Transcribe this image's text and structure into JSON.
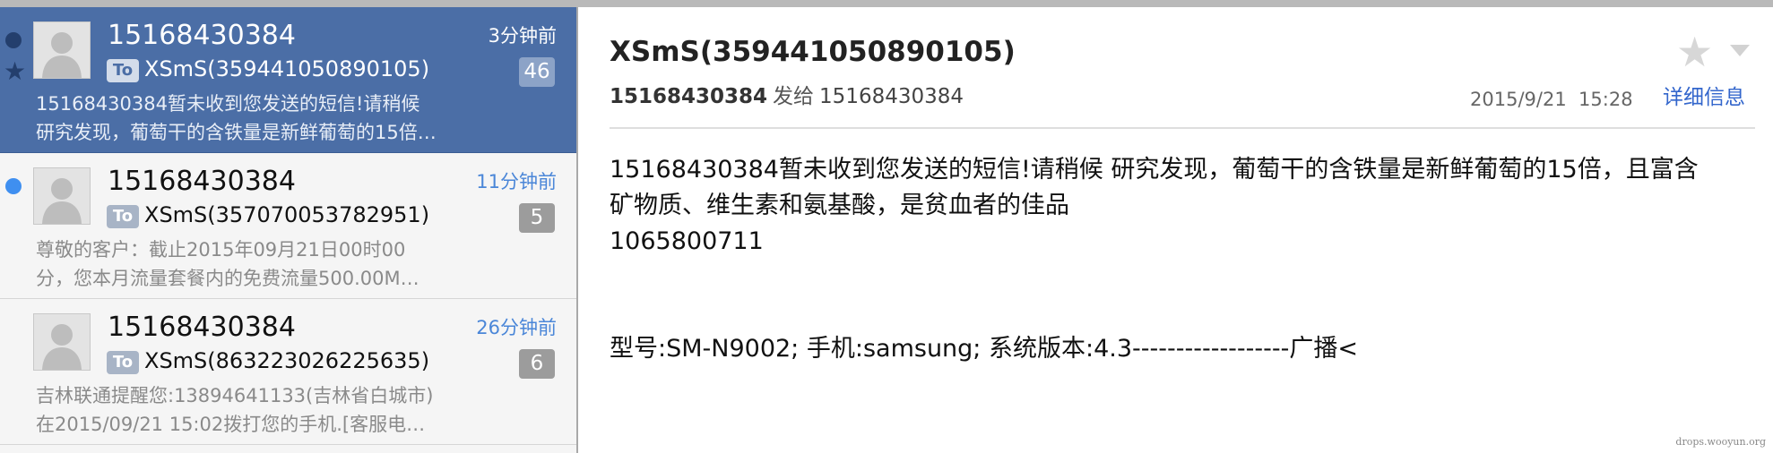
{
  "colors": {
    "selected_bg": "#4b6ea6",
    "unread_dot": "#3f8ff0",
    "link": "#3366cc",
    "time_link": "#4a86d8"
  },
  "messages": [
    {
      "sender": "15168430384",
      "time": "3分钟前",
      "to_label": "To",
      "recipient": "XSmS(359441050890105)",
      "count": "46",
      "preview_line1": "15168430384暂未收到您发送的短信!请稍候",
      "preview_line2": "研究发现，葡萄干的含铁量是新鲜葡萄的15倍…",
      "selected": true
    },
    {
      "sender": "15168430384",
      "time": "11分钟前",
      "to_label": "To",
      "recipient": "XSmS(357070053782951)",
      "count": "5",
      "preview_line1": "尊敬的客户：截止2015年09月21日00时00",
      "preview_line2": "分，您本月流量套餐内的免费流量500.00M…",
      "selected": false
    },
    {
      "sender": "15168430384",
      "time": "26分钟前",
      "to_label": "To",
      "recipient": "XSmS(863223026225635)",
      "count": "6",
      "preview_line1": "吉林联通提醒您:13894641133(吉林省白城市)",
      "preview_line2": "在2015/09/21 15:02拨打您的手机.[客服电…",
      "selected": false
    }
  ],
  "reader": {
    "subject": "XSmS(359441050890105)",
    "from": "15168430384",
    "sent_to_label": "发给",
    "to": "15168430384",
    "date": "2015/9/21",
    "time": "15:28",
    "details_link": "详细信息",
    "body_line1": "15168430384暂未收到您发送的短信!请稍候 研究发现，葡萄干的含铁量是新鲜葡萄的15倍，且富含",
    "body_line2": "矿物质、维生素和氨基酸，是贫血者的佳品",
    "body_line3": "1065800711",
    "body_line4": "型号:SM-N9002; 手机:samsung; 系统版本:4.3------------------广播<"
  },
  "watermark": "drops.wooyun.org"
}
